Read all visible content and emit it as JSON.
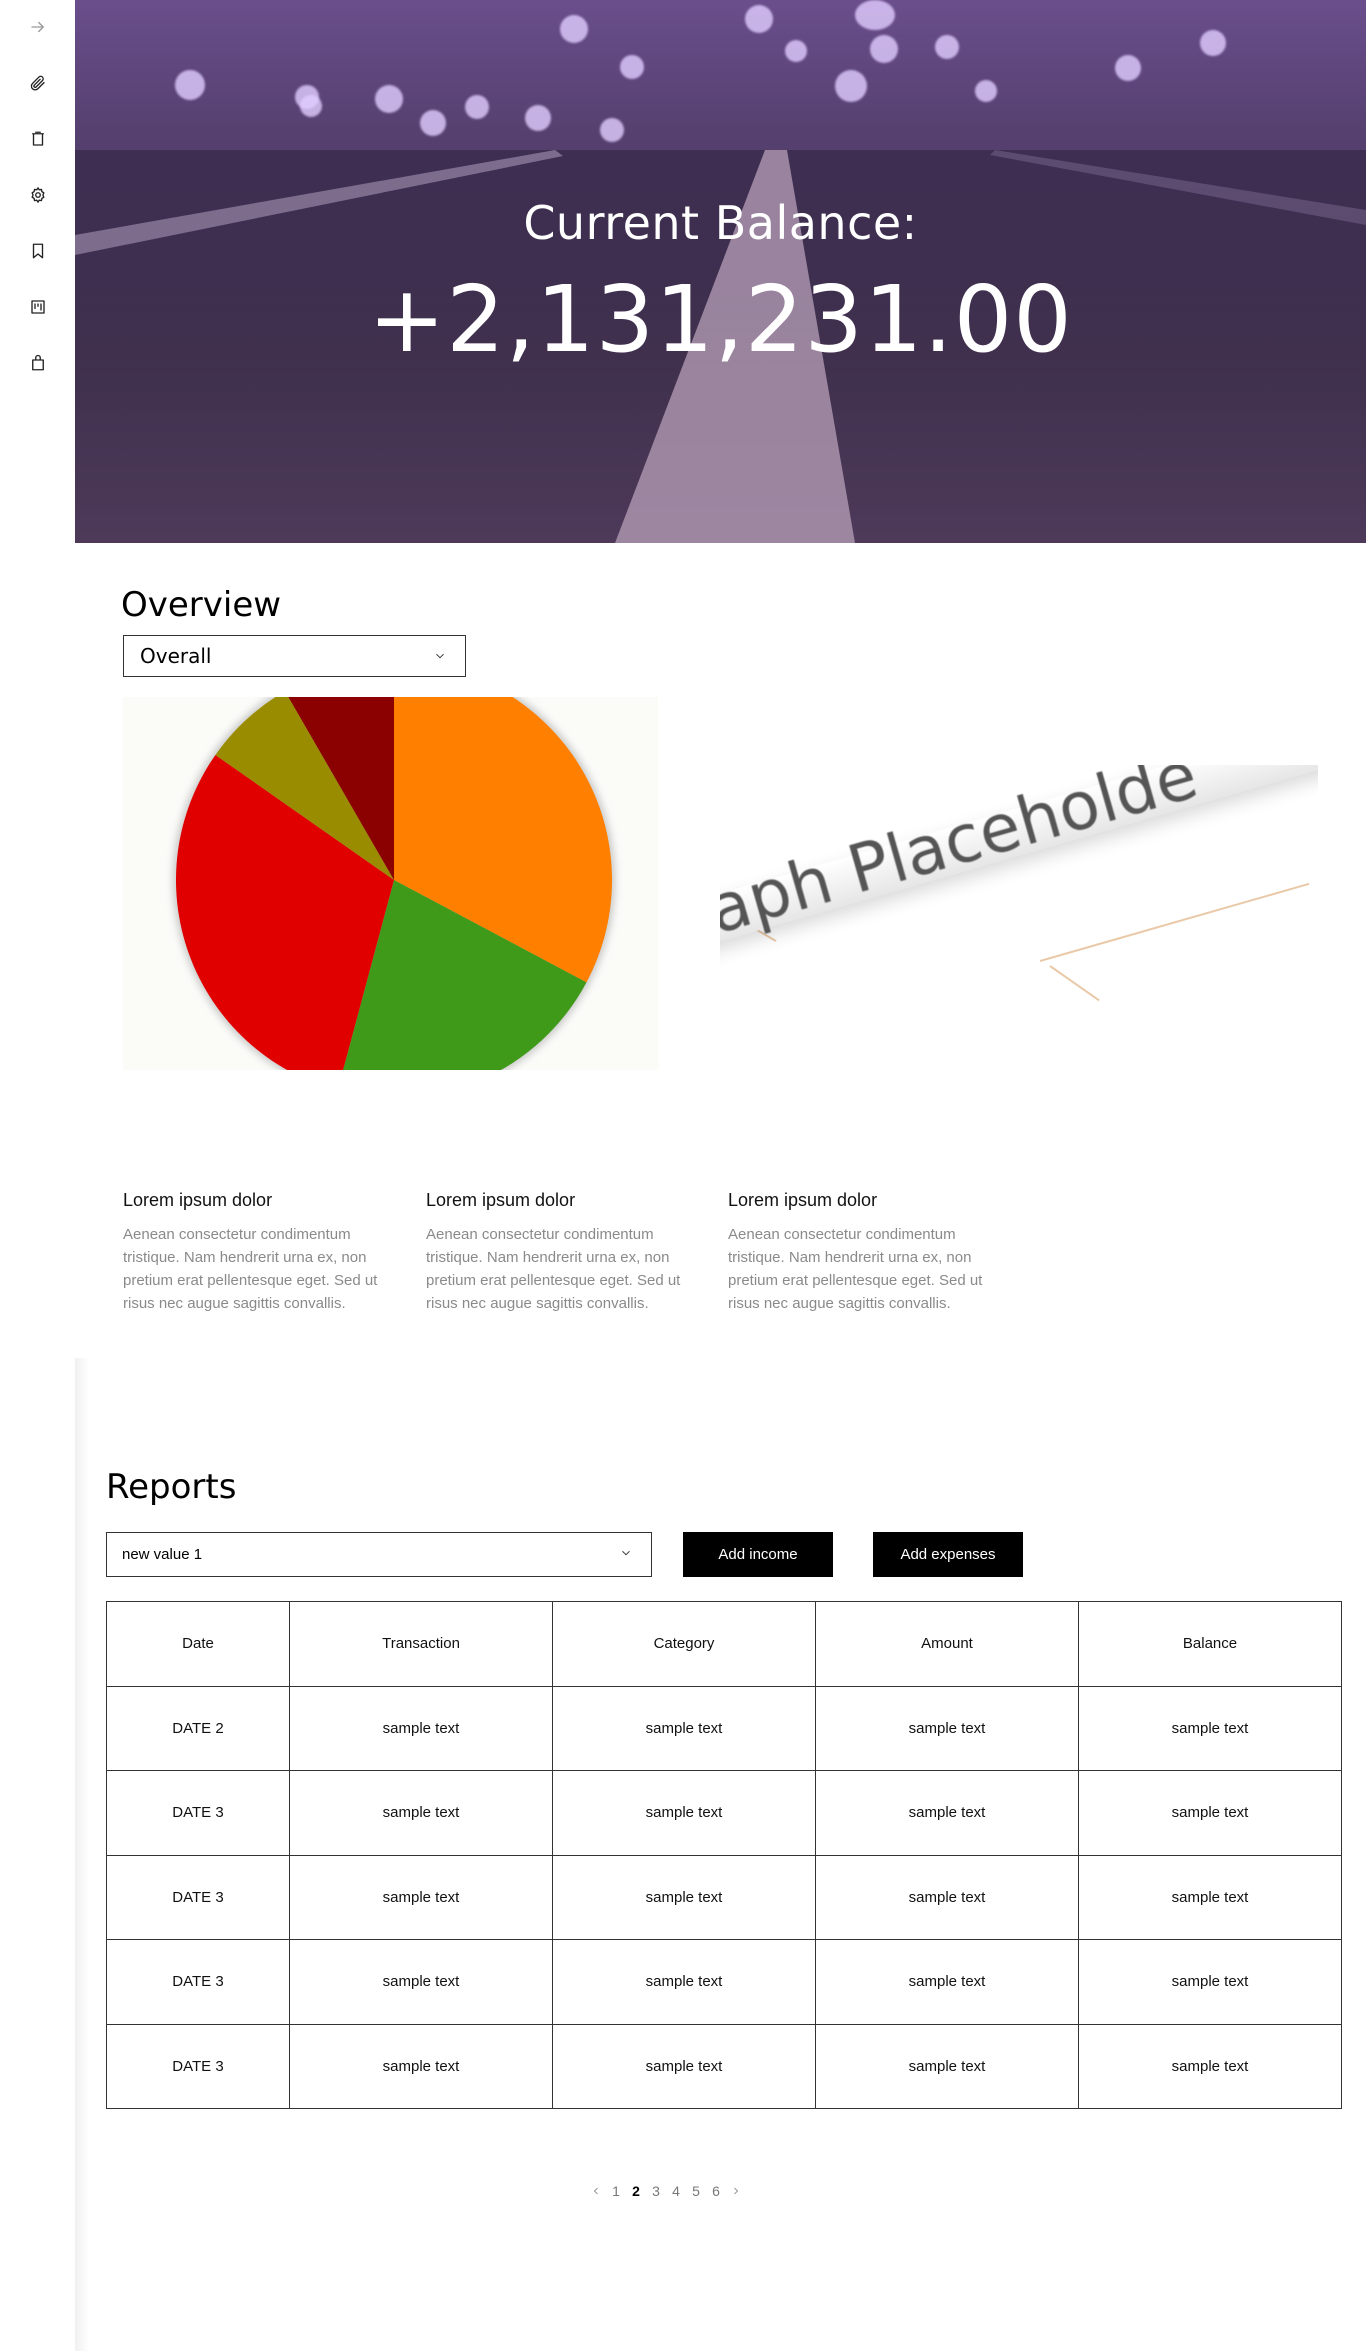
{
  "sidebar": {
    "icons": [
      "arrow-right-icon",
      "paperclip-icon",
      "trash-icon",
      "gear-icon",
      "bookmark-icon",
      "board-icon",
      "shopping-bag-icon"
    ]
  },
  "hero": {
    "label": "Current Balance:",
    "value": "+2,131,231.00"
  },
  "overview": {
    "title": "Overview",
    "select_value": "Overall",
    "pie_colors": [
      "#ff8000",
      "#3f9a1a",
      "#e00000",
      "#9a8c00",
      "#8b0000"
    ],
    "graph_placeholder_text": "aph Placeholde",
    "cards": [
      {
        "title": "Lorem ipsum dolor",
        "text": "Aenean consectetur condimentum tristique. Nam hendrerit urna ex, non pretium erat pellentesque eget. Sed ut risus nec augue sagittis convallis."
      },
      {
        "title": "Lorem ipsum dolor",
        "text": "Aenean consectetur condimentum tristique. Nam hendrerit urna ex, non pretium erat pellentesque eget. Sed ut risus nec augue sagittis convallis."
      },
      {
        "title": "Lorem ipsum dolor",
        "text": "Aenean consectetur condimentum tristique. Nam hendrerit urna ex, non pretium erat pellentesque eget. Sed ut risus nec augue sagittis convallis."
      }
    ]
  },
  "reports": {
    "title": "Reports",
    "select_value": "new value 1",
    "add_income_label": "Add income",
    "add_expenses_label": "Add expenses",
    "columns": [
      "Date",
      "Transaction",
      "Category",
      "Amount",
      "Balance"
    ],
    "rows": [
      [
        "DATE 2",
        "sample text",
        "sample text",
        "sample text",
        "sample text"
      ],
      [
        "DATE 3",
        "sample text",
        "sample text",
        "sample text",
        "sample text"
      ],
      [
        "DATE 3",
        "sample text",
        "sample text",
        "sample text",
        "sample text"
      ],
      [
        "DATE 3",
        "sample text",
        "sample text",
        "sample text",
        "sample text"
      ],
      [
        "DATE 3",
        "sample text",
        "sample text",
        "sample text",
        "sample text"
      ]
    ],
    "pagination": {
      "pages": [
        "1",
        "2",
        "3",
        "4",
        "5",
        "6"
      ],
      "current": "2"
    }
  }
}
